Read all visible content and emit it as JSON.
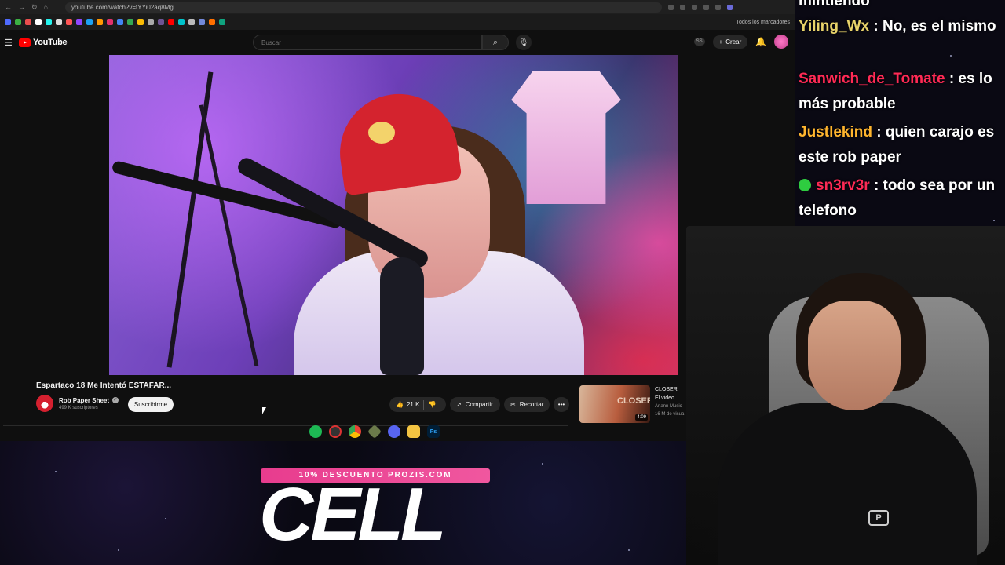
{
  "browser": {
    "url": "youtube.com/watch?v=tYYi02aq8Mg",
    "bookmarks_label": "Todos los marcadores"
  },
  "youtube": {
    "logo_text": "YouTube",
    "search_placeholder": "Buscar",
    "ss_badge": "SS",
    "create_label": "Crear"
  },
  "video": {
    "title": "Espartaco 18 Me Intentó ESTAFAR...",
    "channel": "Rob Paper Sheet",
    "subscribers": "499 K suscriptores",
    "subscribe_label": "Suscribirme",
    "likes": "21 K",
    "share_label": "Compartir",
    "clip_label": "Recortar",
    "more_label": "•••"
  },
  "recommended": {
    "title": "CLOSER",
    "channel": "El video",
    "sub": "Ariann Music",
    "views": "16 M de visua",
    "duration": "4:09",
    "thumb_text": "CLOSER"
  },
  "taskbar": {
    "items": [
      "spotify-icon",
      "app-icon",
      "chrome-icon",
      "game-icon",
      "discord-icon",
      "folder-icon",
      "photoshop-icon"
    ],
    "ps_label": "Ps"
  },
  "promo": {
    "banner": "10% DESCUENTO PROZIS.COM",
    "word": "CELL"
  },
  "chat": {
    "messages": [
      {
        "user": "",
        "text": "mintiendo",
        "color": "#ffffff"
      },
      {
        "user": "Yiling_Wx",
        "text": ": No, es el mismo",
        "color": "#e8d36a"
      },
      {
        "user": "Sanwich_de_Tomate",
        "text": ": es lo más probable",
        "color": "#ff2a55"
      },
      {
        "user": "Justlekind",
        "text": ": quien carajo es este rob paper",
        "color": "#ffb52e"
      },
      {
        "user": "sn3rv3r",
        "text": ": todo sea por un telefono",
        "color": "#ff2a55"
      }
    ]
  },
  "webcam": {
    "logo": "P"
  }
}
